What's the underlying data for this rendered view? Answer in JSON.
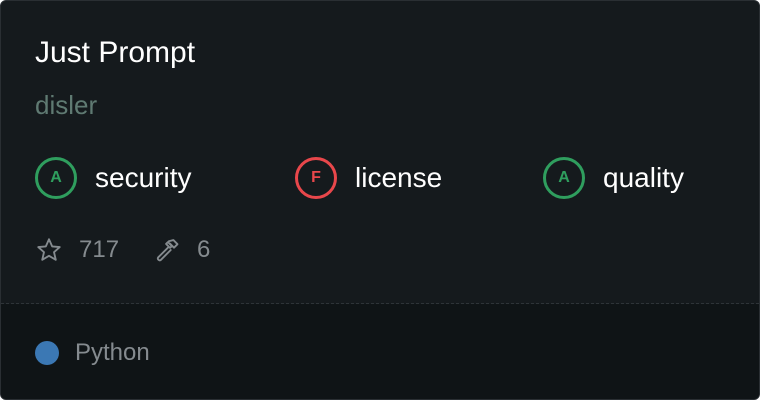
{
  "card": {
    "title": "Just Prompt",
    "owner": "disler"
  },
  "grades": [
    {
      "grade": "A",
      "label": "security",
      "status_color": "#2f9e5e"
    },
    {
      "grade": "F",
      "label": "license",
      "status_color": "#e8474b"
    },
    {
      "grade": "A",
      "label": "quality",
      "status_color": "#2f9e5e"
    }
  ],
  "stats": {
    "stars": "717",
    "stars_icon": "star-icon",
    "tools": "6",
    "tools_icon": "hammer-icon"
  },
  "footer": {
    "language": "Python",
    "language_color": "#3b78b4"
  }
}
